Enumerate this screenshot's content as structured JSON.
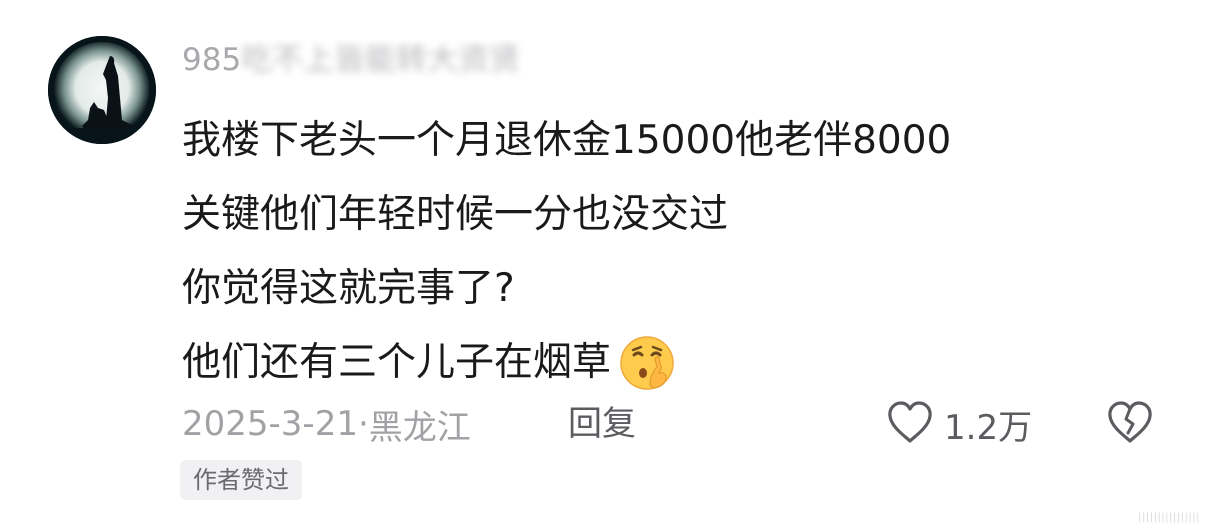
{
  "comment": {
    "username_visible": "985",
    "username_blurred": "吃不上皆能转大资贤",
    "lines": [
      "我楼下老头一个月退休金15000他老伴8000",
      "关键他们年轻时候一分也没交过",
      "你觉得这就完事了?",
      "他们还有三个儿子在烟草"
    ],
    "emoji": "shushing-face-emoji",
    "date": "2025-3-21",
    "location_separator": "·",
    "location": "黑龙江",
    "reply_label": "回复",
    "like_count": "1.2万",
    "author_badge": "作者赞过"
  },
  "watermark": "||||||||||||||||",
  "colors": {
    "text_primary": "#1a1a1a",
    "text_secondary": "#a2a2a6",
    "action_text": "#5b5b60",
    "badge_bg": "#f1f1f3",
    "emoji_yellow": "#ffcb4c"
  }
}
